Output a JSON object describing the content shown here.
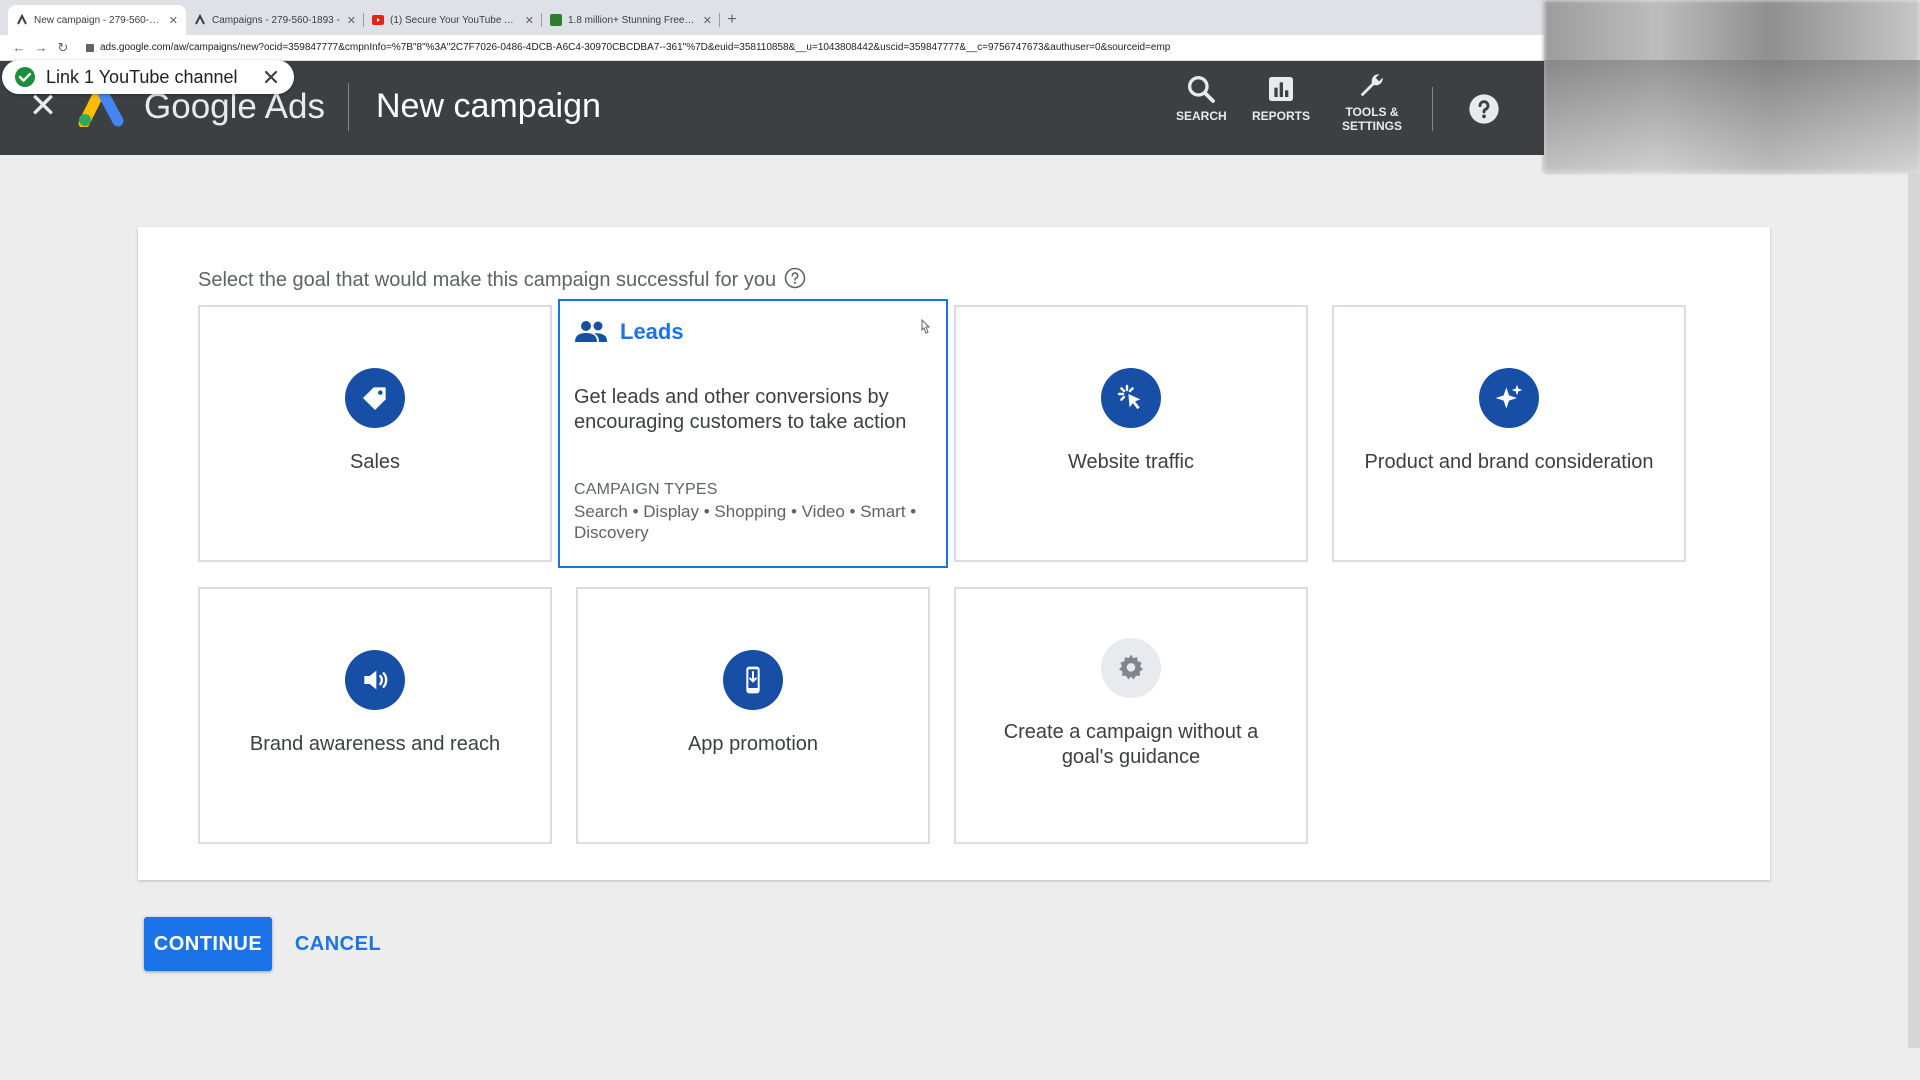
{
  "browser": {
    "tabs": [
      {
        "title": "New campaign - 279-560-189",
        "active": true
      },
      {
        "title": "Campaigns - 279-560-1893 -",
        "active": false
      },
      {
        "title": "(1) Secure Your YouTube Acco",
        "active": false
      },
      {
        "title": "1.8 million+ Stunning Free Ima",
        "active": false
      }
    ],
    "new_tab": "+",
    "url": "ads.google.com/aw/campaigns/new?ocid=359847777&cmpnInfo=%7B\"8\"%3A\"2C7F7026-0486-4DCB-A6C4-30970CBCDBA7--361\"%7D&euid=358110858&__u=1043808442&uscid=359847777&__c=9756747673&authuser=0&sourceid=emp"
  },
  "toast": {
    "text": "Link 1 YouTube channel"
  },
  "header": {
    "brand": "Google Ads",
    "title": "New campaign",
    "search_label": "SEARCH",
    "reports_label": "REPORTS",
    "tools_label_1": "TOOLS &",
    "tools_label_2": "SETTINGS"
  },
  "main": {
    "prompt": "Select the goal that would make this campaign successful for you",
    "goals": {
      "sales": "Sales",
      "leads": {
        "title": "Leads",
        "desc_1": "Get leads and other conversions by",
        "desc_2": "encouraging customers to take action",
        "types_heading": "CAMPAIGN TYPES",
        "types_1": "Search • Display • Shopping • Video • Smart •",
        "types_2": "Discovery"
      },
      "website_traffic": "Website traffic",
      "product_brand": "Product and brand consideration",
      "brand_awareness": "Brand awareness and reach",
      "app_promotion": "App promotion",
      "no_goal_1": "Create a campaign without a",
      "no_goal_2": "goal's guidance"
    }
  },
  "actions": {
    "continue": "CONTINUE",
    "cancel": "CANCEL"
  },
  "colors": {
    "accent": "#1a73e8",
    "icon_bg": "#174ea6",
    "header_bg": "#3c4043"
  }
}
